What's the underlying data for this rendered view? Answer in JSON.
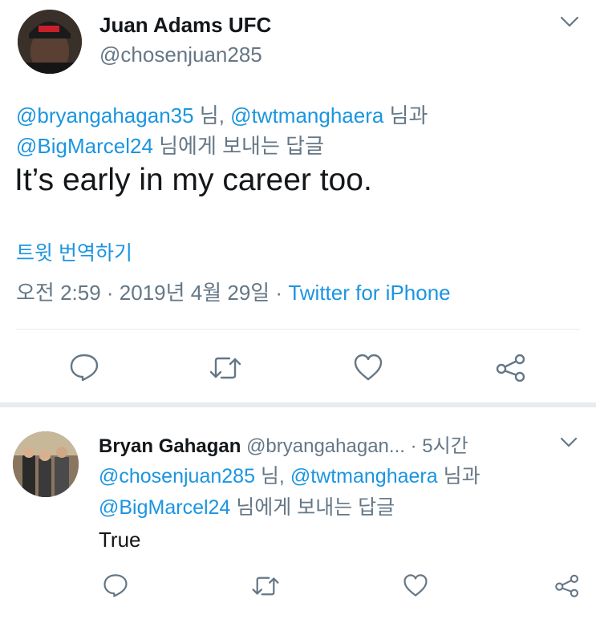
{
  "main_tweet": {
    "author_name": "Juan Adams UFC",
    "author_handle": "@chosenjuan285",
    "reply_mention_1": "@bryangahagan35",
    "reply_sep_1": " 님, ",
    "reply_mention_2": "@twtmanghaera",
    "reply_sep_2": " 님과",
    "reply_mention_3": "@BigMarcel24",
    "reply_suffix": " 님에게 보내는 답글",
    "text": "It’s early in my career too.",
    "translate_label": "트윗 번역하기",
    "timestamp": "오전 2:59 · 2019년 4월 29일 · ",
    "source": "Twitter for iPhone"
  },
  "reply_tweet": {
    "author_name": "Bryan Gahagan",
    "author_handle": "@bryangahagan...",
    "time_ago": "· 5시간",
    "reply_mention_1": "@chosenjuan285",
    "reply_sep_1": " 님, ",
    "reply_mention_2": "@twtmanghaera",
    "reply_sep_2": " 님과",
    "reply_mention_3": "@BigMarcel24",
    "reply_suffix": " 님에게 보내는 답글",
    "text": "True"
  },
  "icons": [
    "chevron-down-icon",
    "reply-icon",
    "retweet-icon",
    "like-icon",
    "share-icon"
  ],
  "colors": {
    "link": "#1b95e0",
    "secondary": "#657786",
    "divider": "#e6ecf0"
  }
}
